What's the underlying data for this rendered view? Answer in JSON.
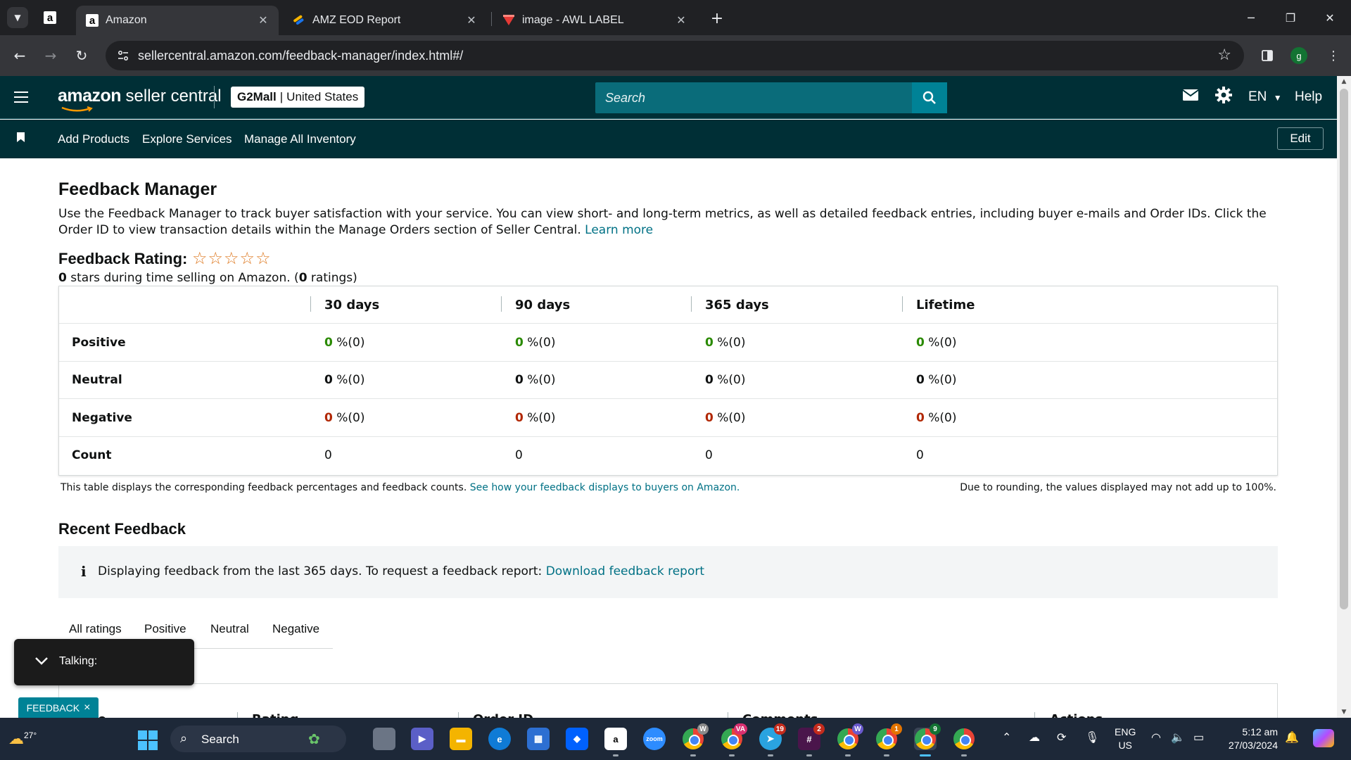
{
  "browser": {
    "tabs": [
      {
        "title": "Amazon",
        "active": true
      },
      {
        "title": "AMZ EOD Report",
        "active": false
      },
      {
        "title": "image - AWL LABEL",
        "active": false
      }
    ],
    "url": "sellercentral.amazon.com/feedback-manager/index.html#/",
    "profile_initial": "g"
  },
  "header": {
    "logo_amazon": "amazon",
    "logo_sc": "seller central",
    "store_name": "G2Mall",
    "store_sep": "|",
    "store_region": "United States",
    "search_placeholder": "Search",
    "language": "EN",
    "help": "Help"
  },
  "nav": {
    "links": [
      "Add Products",
      "Explore Services",
      "Manage All Inventory"
    ],
    "edit": "Edit"
  },
  "page": {
    "title": "Feedback Manager",
    "description": "Use the Feedback Manager to track buyer satisfaction with your service. You can view short- and long-term metrics, as well as detailed feedback entries, including buyer e-mails and Order IDs. Click the Order ID to view transaction details within the Manage Orders section of Seller Central.",
    "learn_more": "Learn more",
    "rating_title": "Feedback Rating:",
    "rating_stars": "☆☆☆☆☆",
    "rating_value": "0",
    "rating_sub_1": " stars during time selling on Amazon. (",
    "rating_count": "0",
    "rating_sub_2": " ratings)"
  },
  "metrics": {
    "columns": [
      "30 days",
      "90 days",
      "365 days",
      "Lifetime"
    ],
    "rows": [
      {
        "label": "Positive",
        "cells": [
          {
            "v": "0",
            "s": " %(0)"
          },
          {
            "v": "0",
            "s": " %(0)"
          },
          {
            "v": "0",
            "s": " %(0)"
          },
          {
            "v": "0",
            "s": " %(0)"
          }
        ]
      },
      {
        "label": "Neutral",
        "cells": [
          {
            "v": "0",
            "s": " %(0)"
          },
          {
            "v": "0",
            "s": " %(0)"
          },
          {
            "v": "0",
            "s": " %(0)"
          },
          {
            "v": "0",
            "s": " %(0)"
          }
        ]
      },
      {
        "label": "Negative",
        "cells": [
          {
            "v": "0",
            "s": " %(0)"
          },
          {
            "v": "0",
            "s": " %(0)"
          },
          {
            "v": "0",
            "s": " %(0)"
          },
          {
            "v": "0",
            "s": " %(0)"
          }
        ]
      },
      {
        "label": "Count",
        "cells": [
          {
            "v": "0",
            "s": ""
          },
          {
            "v": "0",
            "s": ""
          },
          {
            "v": "0",
            "s": ""
          },
          {
            "v": "0",
            "s": ""
          }
        ]
      }
    ],
    "note_left": "This table displays the corresponding feedback percentages and feedback counts.",
    "note_link": "See how your feedback displays to buyers on Amazon.",
    "note_right": "Due to rounding, the values displayed may not add up to 100%."
  },
  "recent": {
    "title": "Recent Feedback",
    "info_icon": "i",
    "info_text": "Displaying feedback from the last 365 days. To request a feedback report:",
    "info_link": "Download feedback report",
    "tabs": [
      "All ratings",
      "Positive",
      "Neutral",
      "Negative"
    ],
    "columns": [
      "e",
      "Rating",
      "Order ID",
      "Comments",
      "Actions"
    ]
  },
  "overlays": {
    "talking": "Talking:",
    "feedback_tag": "FEEDBACK",
    "feedback_close": "×"
  },
  "taskbar": {
    "temperature": "27°",
    "search": "Search",
    "lang_1": "ENG",
    "lang_2": "US",
    "time": "5:12 am",
    "date": "27/03/2024",
    "badges": {
      "va": "VA",
      "telegram": "19",
      "slack": "2",
      "chrome_w1": "W",
      "chrome_w2": "W",
      "chrome_1": "1",
      "chrome_9": "9"
    }
  },
  "colors": {
    "header_bg": "#002f36",
    "search_bg": "#0a6c7a",
    "link": "#007185",
    "positive": "#2a8a00",
    "negative": "#b12704"
  }
}
